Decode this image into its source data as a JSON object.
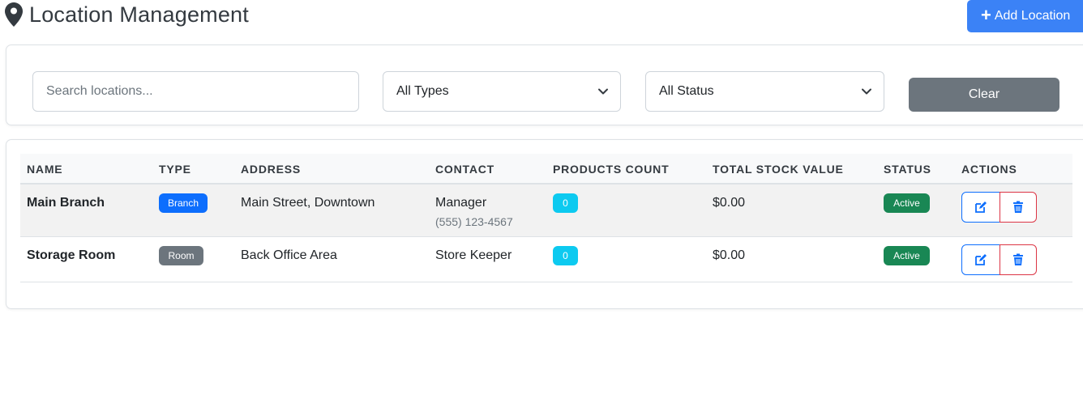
{
  "header": {
    "title": "Location Management",
    "title_icon": "map-pin-icon",
    "add_button_label": "Add Location"
  },
  "filters": {
    "search_placeholder": "Search locations...",
    "search_value": "",
    "type_selected": "All Types",
    "status_selected": "All Status",
    "clear_label": "Clear"
  },
  "table": {
    "columns": [
      "NAME",
      "TYPE",
      "ADDRESS",
      "CONTACT",
      "PRODUCTS COUNT",
      "TOTAL STOCK VALUE",
      "STATUS",
      "ACTIONS"
    ],
    "rows": [
      {
        "name": "Main Branch",
        "type": "Branch",
        "address": "Main Street, Downtown",
        "contact_name": "Manager",
        "contact_phone": "(555) 123-4567",
        "products_count": "0",
        "stock_value": "$0.00",
        "status": "Active"
      },
      {
        "name": "Storage Room",
        "type": "Room",
        "address": "Back Office Area",
        "contact_name": "Store Keeper",
        "contact_phone": "",
        "products_count": "0",
        "stock_value": "$0.00",
        "status": "Active"
      }
    ]
  },
  "colors": {
    "primary": "#3b82f6",
    "branch_badge": "#0d6efd",
    "room_badge": "#6c757d",
    "count_badge": "#0dcaf0",
    "active_badge": "#198754",
    "danger": "#dc3545"
  },
  "icons": {
    "edit": "edit-icon",
    "delete": "trash-icon",
    "chevron": "chevron-down-icon",
    "add": "plus-icon"
  }
}
